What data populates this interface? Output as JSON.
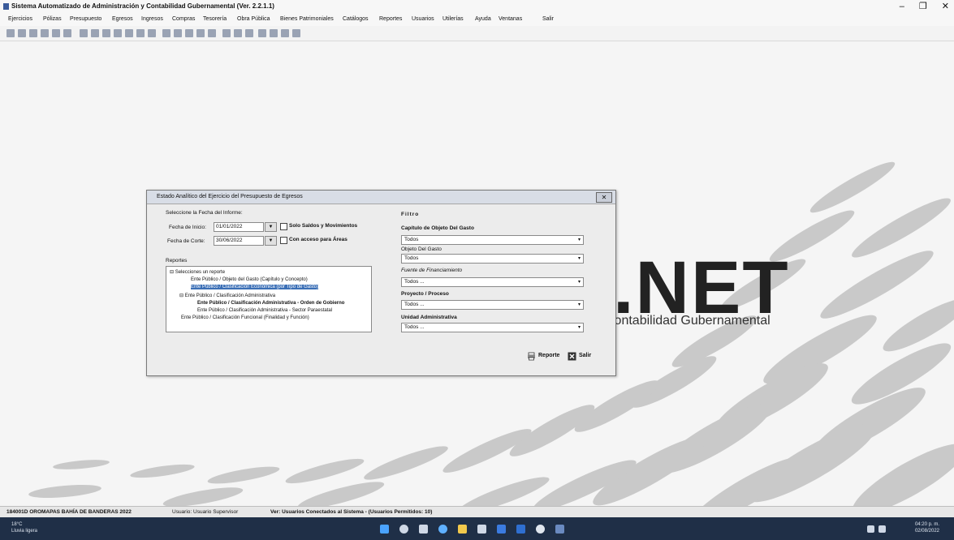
{
  "window": {
    "title": "Sistema Automatizado de Administración y Contabilidad Gubernamental (Ver. 2.2.1.1)",
    "controls": [
      "–",
      "❐",
      "✕"
    ]
  },
  "menu": [
    "Ejercicios",
    "Pólizas",
    "Presupuesto",
    "Egresos",
    "Ingresos",
    "Compras",
    "Tesorería",
    "Obra Pública",
    "Bienes Patrimoniales",
    "Catálogos",
    "Reportes",
    "Usuarios",
    "Utilerías",
    "Ayuda",
    "Ventanas",
    "Salir"
  ],
  "background": {
    "brand": ".NET",
    "subtitle": "Contabilidad Gubernamental"
  },
  "dialog": {
    "title": "Estado Analítico del Ejercicio del Presupuesto de Egresos",
    "close": "✕",
    "date_section_label": "Seleccione la Fecha del Informe:",
    "fecha_inicio_label": "Fecha de Inicio:",
    "fecha_inicio_value": "01/01/2022",
    "fecha_corte_label": "Fecha de Corte:",
    "fecha_corte_value": "30/06/2022",
    "chk_saldos": "Solo Saldos y Movimientos",
    "chk_areas": "Con acceso para Áreas",
    "reportes_label": "Reportes",
    "tree": [
      "⊟ Selecciones un reporte",
      "Ente Público / Objeto del Gasto (Capítulo y Concepto)",
      "Ente Público / Clasificación Económica (por Tipo de Gasto)",
      "⊟ Ente Público / Clasificación Administrativa",
      "Ente Público / Clasificación Administrativa - Orden de Gobierno",
      "Ente Público / Clasificación Administrativa - Sector Paraestatal",
      "Ente Público / Clasificación Funcional (Finalidad y Función)"
    ],
    "filtro_label": "Filtro",
    "capitulo_label": "Capítulo de Objeto Del Gasto",
    "capitulo_value": "Todos",
    "objeto_label": "Objeto Del Gasto",
    "objeto_value": "Todos",
    "fuente_label": "Fuente de Financiamiento",
    "fuente_value": "Todos ...",
    "proyecto_label": "Proyecto / Proceso",
    "proyecto_value": "Todos ...",
    "unidad_label": "Unidad Administrativa",
    "unidad_value": "Todos ...",
    "btn_reporte": "Reporte",
    "btn_salir": "Salir"
  },
  "statusbar": {
    "ente": "184001D OROMAPAS BAHÍA DE BANDERAS 2022",
    "usuario": "Usuario: Usuario Supervisor",
    "conectados": "Ver: Usuarios Conectados al Sistema - (Usuarios Permitidos: 10)"
  },
  "taskbar": {
    "weather_temp": "18°C",
    "weather_desc": "Lluvia ligera",
    "time": "04:20 p. m.",
    "date": "02/08/2022"
  }
}
